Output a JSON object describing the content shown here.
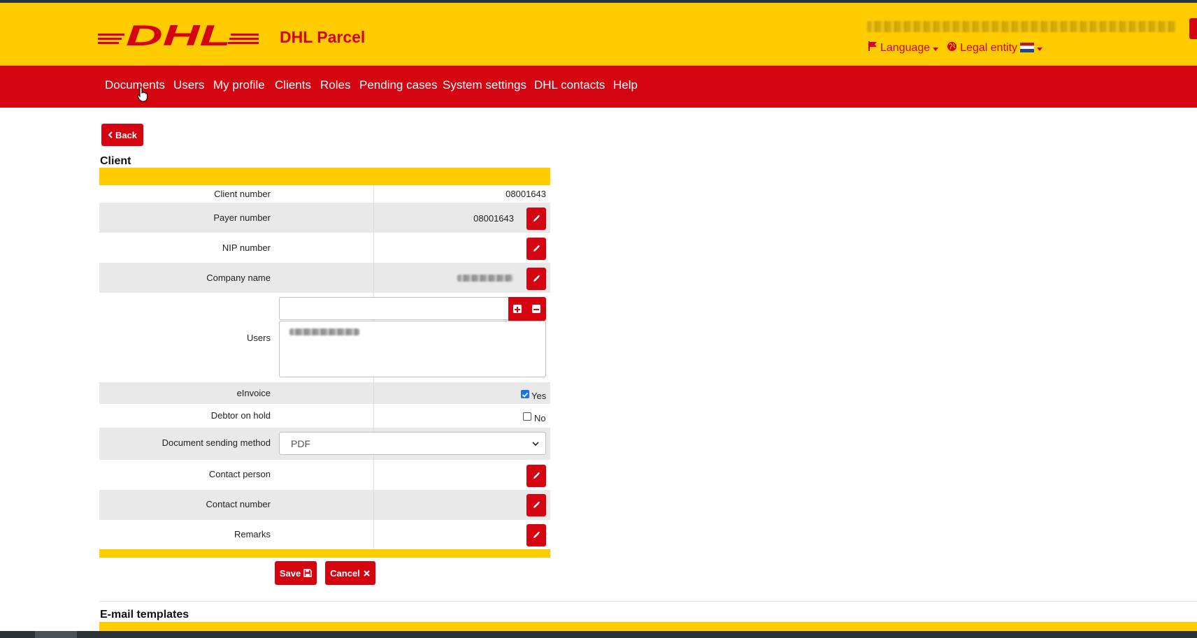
{
  "header": {
    "brand": "DHL Parcel",
    "logo_text": "DHL",
    "language_label": "Language",
    "legal_entity_label": "Legal entity"
  },
  "nav": {
    "items": [
      "Documents",
      "Users",
      "My profile",
      "Clients",
      "Roles",
      "Pending cases",
      "System settings",
      "DHL contacts",
      "Help"
    ]
  },
  "back_label": "Back",
  "client_section": {
    "title": "Client",
    "rows": {
      "client_number": {
        "label": "Client number",
        "value": "08001643"
      },
      "payer_number": {
        "label": "Payer number",
        "value": "08001643"
      },
      "nip_number": {
        "label": "NIP number"
      },
      "company_name": {
        "label": "Company name"
      },
      "users": {
        "label": "Users"
      },
      "einvoice": {
        "label": "eInvoice",
        "value_label": "Yes",
        "checked": true
      },
      "debtor_on_hold": {
        "label": "Debtor on hold",
        "value_label": "No",
        "checked": false
      },
      "document_sending_method": {
        "label": "Document sending method",
        "selected": "PDF"
      },
      "contact_person": {
        "label": "Contact person"
      },
      "contact_number": {
        "label": "Contact number"
      },
      "remarks": {
        "label": "Remarks"
      }
    },
    "save_label": "Save",
    "cancel_label": "Cancel"
  },
  "email_templates": {
    "title": "E-mail templates"
  },
  "colors": {
    "brand_yellow": "#ffcc00",
    "brand_red": "#d40511",
    "row_alt": "#e9e9e9"
  },
  "icons": [
    "flag-icon",
    "globe-icon",
    "chevron-left-icon",
    "pencil-icon",
    "plus-icon",
    "minus-icon",
    "floppy-disk-icon",
    "x-icon",
    "chevron-down-icon"
  ]
}
